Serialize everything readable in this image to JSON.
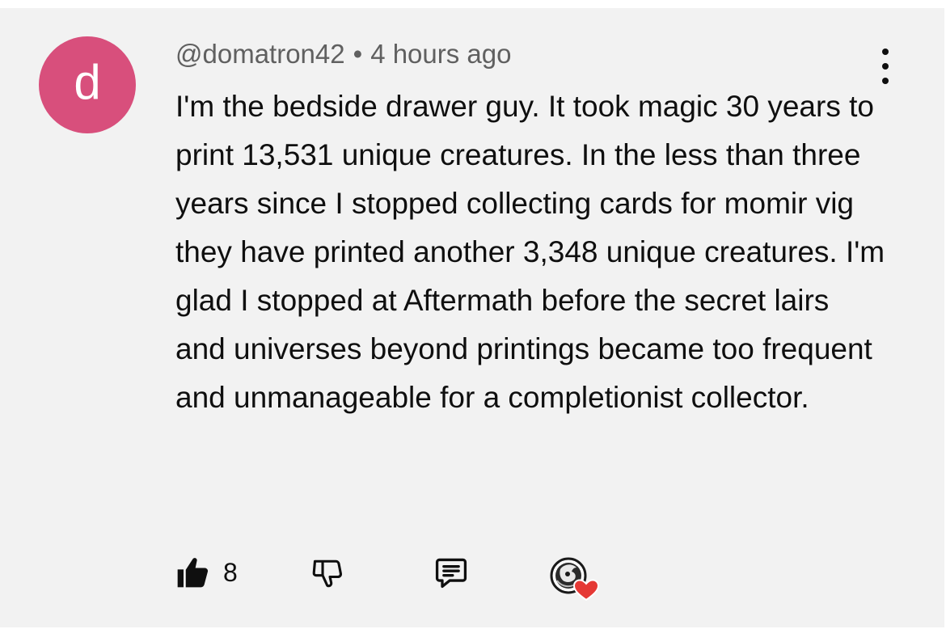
{
  "comment": {
    "avatar_letter": "d",
    "avatar_color": "#d84f7c",
    "author": "@domatron42",
    "separator": "•",
    "timestamp": "4 hours ago",
    "text": "I'm the bedside drawer guy. It took magic 30 years to print 13,531 unique creatures. In the less than three years since I stopped collecting cards for momir vig they have printed another 3,348 unique creatures. I'm glad I stopped at Aftermath before the secret lairs and universes beyond printings became too frequent and unmanageable for a completionist collector.",
    "like_count": "8"
  },
  "icons": {
    "more": "more-vertical-icon",
    "like": "thumbs-up-icon",
    "dislike": "thumbs-down-icon",
    "reply": "reply-icon",
    "creator_heart": "creator-heart-icon"
  },
  "colors": {
    "heart": "#e53935",
    "text": "#0f0f0f",
    "meta": "#606060"
  }
}
